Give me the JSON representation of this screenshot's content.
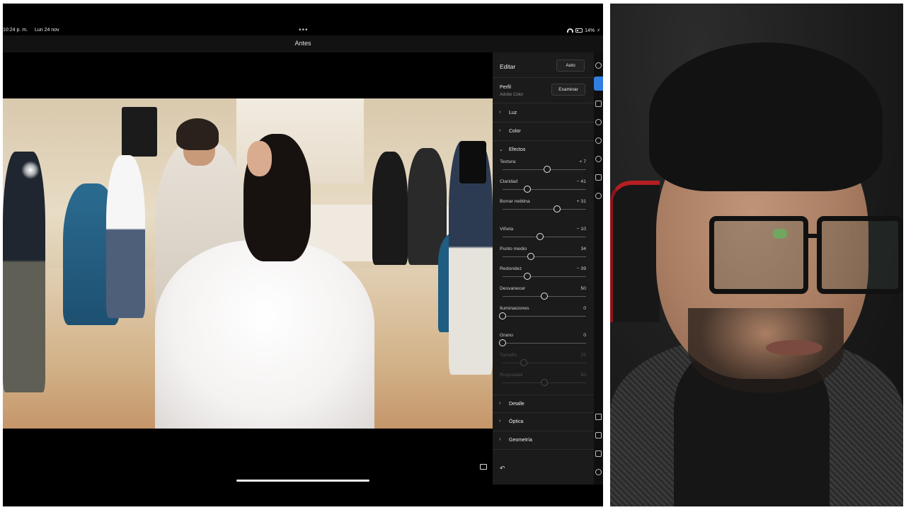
{
  "status": {
    "time": "10:24 p. m.",
    "date": "Lun 24 nov",
    "battery": "14%"
  },
  "topbar": {
    "title": "Antes"
  },
  "panel": {
    "title": "Editar",
    "auto_label": "Auto",
    "profile": {
      "label": "Perfil",
      "value": "Adobe Color",
      "browse_label": "Examinar"
    },
    "sections": {
      "luz": "Luz",
      "color": "Color",
      "efectos": "Efectos",
      "detalle": "Detalle",
      "optica": "Óptica",
      "geometria": "Geometría"
    },
    "sliders": [
      {
        "label": "Textura",
        "value": "+ 7",
        "fraction": 0.53,
        "dim": false
      },
      {
        "label": "Claridad",
        "value": "− 41",
        "fraction": 0.3,
        "dim": false
      },
      {
        "label": "Borrar neblina",
        "value": "+ 31",
        "fraction": 0.65,
        "dim": false
      },
      {
        "label": "Viñeta",
        "value": "− 10",
        "fraction": 0.45,
        "dim": false
      },
      {
        "label": "Punto medio",
        "value": "34",
        "fraction": 0.34,
        "dim": false
      },
      {
        "label": "Redondez",
        "value": "− 39",
        "fraction": 0.3,
        "dim": false
      },
      {
        "label": "Desvanecer",
        "value": "50",
        "fraction": 0.5,
        "dim": false
      },
      {
        "label": "Iluminaciones",
        "value": "0",
        "fraction": 0.0,
        "dim": false
      },
      {
        "label": "Grano",
        "value": "0",
        "fraction": 0.0,
        "dim": false
      },
      {
        "label": "Tamaño",
        "value": "25",
        "fraction": 0.25,
        "dim": true
      },
      {
        "label": "Rugosidad",
        "value": "50",
        "fraction": 0.5,
        "dim": true
      }
    ]
  },
  "icons": {
    "undo": "undo-icon",
    "edit": "edit-panel-icon"
  }
}
